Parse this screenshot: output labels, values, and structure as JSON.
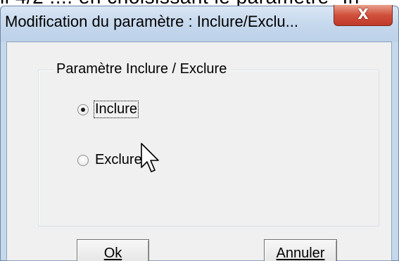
{
  "background": {
    "clipped_text": "ll 4/2 .... en choisissant le paramètre \"In"
  },
  "dialog": {
    "title": "Modification du paramètre : Inclure/Exclu...",
    "close_glyph": "X",
    "group": {
      "label": "Paramètre Inclure / Exclure",
      "options": [
        {
          "label": "Inclure",
          "selected": true,
          "focused": true
        },
        {
          "label": "Exclure",
          "selected": false,
          "focused": false
        }
      ]
    },
    "buttons": {
      "ok_label": "Ok",
      "cancel_label": "Annuler"
    }
  },
  "icons": {
    "close": "close-icon",
    "pointer": "mouse-pointer-icon"
  },
  "colors": {
    "titlebar": "#c3d6ec",
    "close_button": "#d0503a",
    "client_bg": "#f0f0f0"
  }
}
